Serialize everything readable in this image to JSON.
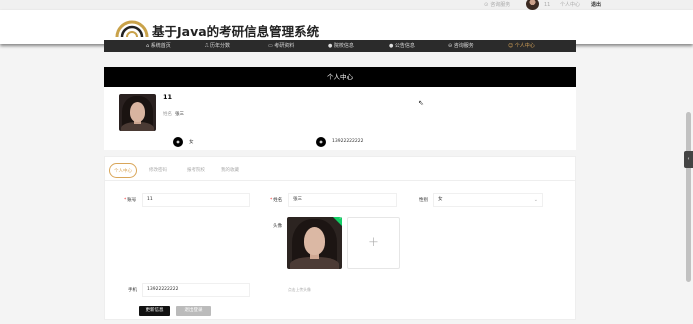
{
  "topbar": {
    "consult_label": "咨询服务",
    "username": "11",
    "user_center_label": "个人中心",
    "logout_label": "退出"
  },
  "header": {
    "title": "基于Java的考研信息管理系统"
  },
  "nav": {
    "items": [
      {
        "label": "系统首页",
        "icon": "home-icon"
      },
      {
        "label": "历年分数",
        "icon": "chart-icon"
      },
      {
        "label": "考研资料",
        "icon": "book-icon"
      },
      {
        "label": "院校信息",
        "icon": "info-icon"
      },
      {
        "label": "公告信息",
        "icon": "notice-icon"
      },
      {
        "label": "咨询服务",
        "icon": "chat-icon"
      },
      {
        "label": "个人中心",
        "icon": "user-icon",
        "active": true
      }
    ]
  },
  "section": {
    "title": "个人中心"
  },
  "profile": {
    "username": "11",
    "name_label": "姓名",
    "name": "张三",
    "sex": "女",
    "phone": "13922222222"
  },
  "tabs": [
    {
      "label": "个人中心",
      "active": true
    },
    {
      "label": "修改密码"
    },
    {
      "label": "报考院校"
    },
    {
      "label": "我的收藏"
    }
  ],
  "form": {
    "account_label": "账号",
    "account_value": "11",
    "name_label": "姓名",
    "name_value": "张三",
    "sex_label": "性别",
    "sex_value": "女",
    "avatar_label": "头像",
    "upload_hint": "点击上传头像",
    "phone_label": "手机",
    "phone_value": "13922222222",
    "update_button": "更新信息",
    "logout_button": "退出登录"
  },
  "colors": {
    "accent": "#d9a65a",
    "nav_bg": "#2b2b2b",
    "section_bg": "#000000"
  }
}
